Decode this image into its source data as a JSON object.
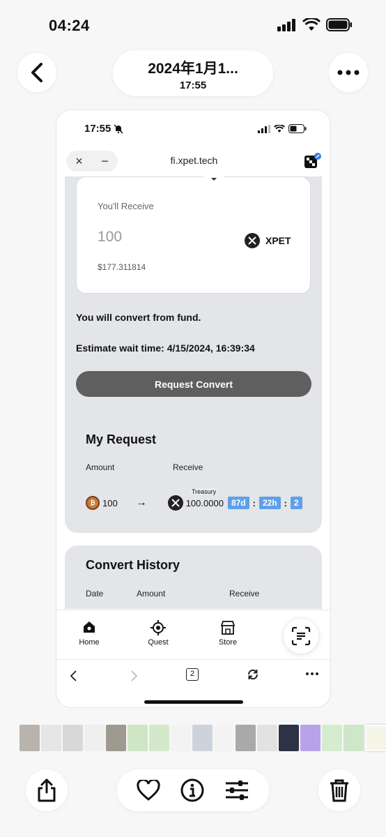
{
  "outer_status": {
    "time": "04:24"
  },
  "header": {
    "date": "2024年1月1...",
    "time": "17:55"
  },
  "inner_status": {
    "time": "17:55"
  },
  "browser": {
    "url": "fi.xpet.tech",
    "close": "×",
    "minimize": "−"
  },
  "receive_card": {
    "label": "You'll Receive",
    "amount": "100",
    "usd_value": "$177.311814",
    "token": "XPET"
  },
  "convert_info": {
    "source_text": "You will convert from fund.",
    "wait_time": "Estimate wait time: 4/15/2024, 16:39:34",
    "button": "Request Convert"
  },
  "my_request": {
    "title": "My Request",
    "col_amount": "Amount",
    "col_receive": "Receive",
    "amount": "100",
    "arrow": "→",
    "badge": "Treasury",
    "receive": "100.0000",
    "countdown_days": "87d",
    "sep1": ":",
    "countdown_hours": "22h",
    "sep2": ":",
    "countdown_min": "2"
  },
  "convert_history": {
    "title": "Convert History",
    "col_date": "Date",
    "col_amount": "Amount",
    "col_receive": "Receive"
  },
  "tabbar": [
    {
      "label": "Home",
      "icon": "home-icon"
    },
    {
      "label": "Quest",
      "icon": "target-icon"
    },
    {
      "label": "Store",
      "icon": "store-icon"
    }
  ],
  "browser_nav": {
    "tab_count": "2"
  },
  "colors": {
    "panel": "#e3e5e8",
    "button": "#5f5f5f",
    "chip": "#5ea0ea"
  }
}
